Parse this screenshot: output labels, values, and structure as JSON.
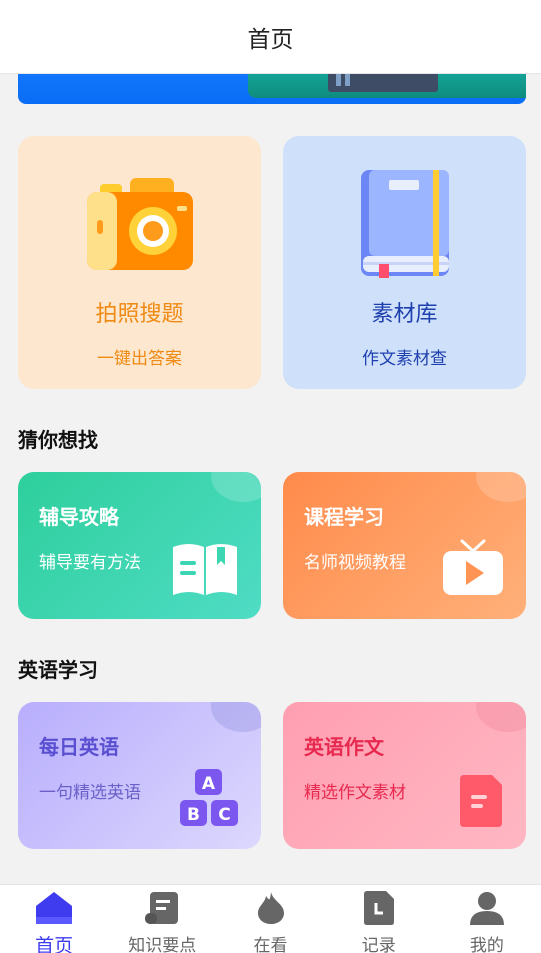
{
  "header": {
    "title": "首页"
  },
  "feature_cards": [
    {
      "title": "拍照搜题",
      "subtitle": "一键出答案",
      "icon": "camera-icon"
    },
    {
      "title": "素材库",
      "subtitle": "作文素材查",
      "icon": "book-icon"
    }
  ],
  "section_guess": {
    "title": "猜你想找",
    "cards": [
      {
        "title": "辅导攻略",
        "subtitle": "辅导要有方法",
        "icon": "open-book-icon"
      },
      {
        "title": "课程学习",
        "subtitle": "名师视频教程",
        "icon": "tv-play-icon"
      }
    ]
  },
  "section_english": {
    "title": "英语学习",
    "cards": [
      {
        "title": "每日英语",
        "subtitle": "一句精选英语",
        "icon": "abc-blocks-icon",
        "letters": [
          "A",
          "B",
          "C"
        ]
      },
      {
        "title": "英语作文",
        "subtitle": "精选作文素材",
        "icon": "document-icon"
      }
    ]
  },
  "tabbar": {
    "items": [
      {
        "label": "首页",
        "icon": "home-icon",
        "active": true
      },
      {
        "label": "知识要点",
        "icon": "scroll-icon",
        "active": false
      },
      {
        "label": "在看",
        "icon": "flame-icon",
        "active": false
      },
      {
        "label": "记录",
        "icon": "record-file-icon",
        "active": false
      },
      {
        "label": "我的",
        "icon": "user-icon",
        "active": false
      }
    ]
  },
  "colors": {
    "accent": "#3f3cf0",
    "orange_text": "#ef8a12",
    "blue_text": "#1e3fae"
  }
}
